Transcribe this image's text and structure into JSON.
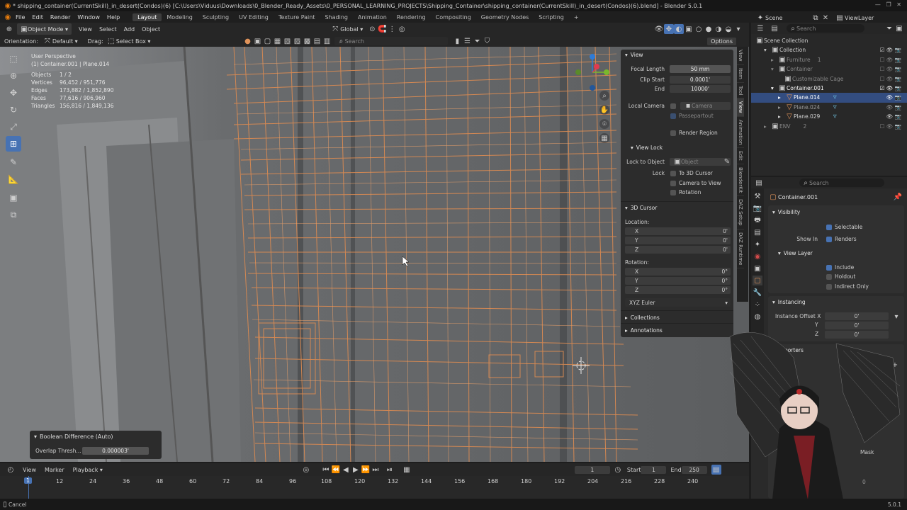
{
  "window": {
    "title": "* shipping_container(CurrentSkill)_in_desert(Condos)(6) [C:\\Users\\Viduus\\Downloads\\0_Blender_Ready_Assets\\0_PERSONAL_LEARNING_PROJECTS\\Shipping_Container\\shipping_container(CurrentSkill)_in_desert(Condos)(6).blend] - Blender 5.0.1"
  },
  "menu": [
    "File",
    "Edit",
    "Render",
    "Window",
    "Help"
  ],
  "workspaces": [
    "Layout",
    "Modeling",
    "Sculpting",
    "UV Editing",
    "Texture Paint",
    "Shading",
    "Animation",
    "Rendering",
    "Compositing",
    "Geometry Nodes",
    "Scripting"
  ],
  "workspace_add": "+",
  "scene": {
    "label": "Scene",
    "viewlayer": "ViewLayer"
  },
  "viewport_header": {
    "mode": "Object Mode",
    "menus": [
      "View",
      "Select",
      "Add",
      "Object"
    ],
    "transform": "Global",
    "options": "Options"
  },
  "sub_header": {
    "orientation_label": "Orientation:",
    "orientation_value": "Default",
    "drag_label": "Drag:",
    "drag_value": "Select Box",
    "search_placeholder": "Search"
  },
  "overlay_info": {
    "perspective": "User Perspective",
    "context": "(1) Container.001 | Plane.014"
  },
  "stats": [
    {
      "label": "Objects",
      "value": "1 / 2"
    },
    {
      "label": "Vertices",
      "value": "96,452 / 951,776"
    },
    {
      "label": "Edges",
      "value": "173,882 / 1,852,890"
    },
    {
      "label": "Faces",
      "value": "77,616 / 906,960"
    },
    {
      "label": "Triangles",
      "value": "156,816 / 1,849,136"
    }
  ],
  "npanel": {
    "view_header": "View",
    "focal_length_label": "Focal Length",
    "focal_length": "50 mm",
    "clip_start_label": "Clip Start",
    "clip_start": "0.0001'",
    "end_label": "End",
    "end": "10000'",
    "local_camera_label": "Local Camera",
    "camera_placeholder": "Camera",
    "passepartout": "Passepartout",
    "render_region": "Render Region",
    "view_lock_header": "View Lock",
    "lock_to_object_label": "Lock to Object",
    "object_placeholder": "Object",
    "lock_label": "Lock",
    "to_3d_cursor": "To 3D Cursor",
    "camera_to_view": "Camera to View",
    "rotation_cb": "Rotation",
    "cursor_header": "3D Cursor",
    "location_label": "Location:",
    "rotation_label": "Rotation:",
    "x": "X",
    "y": "Y",
    "z": "Z",
    "loc": [
      "0'",
      "0'",
      "0'"
    ],
    "rot": [
      "0°",
      "0°",
      "0°"
    ],
    "rot_mode": "XYZ Euler",
    "collections": "Collections",
    "annotations": "Annotations"
  },
  "side_tabs": [
    "View",
    "Item",
    "Tool",
    "View",
    "Animation",
    "Edit",
    "BlenderKit",
    "DAZ Setup",
    "DAZ Runtime"
  ],
  "outliner": {
    "search_placeholder": "Search",
    "rows": [
      {
        "label": "Scene Collection",
        "indent": 0,
        "dim": false
      },
      {
        "label": "Collection",
        "indent": 1,
        "dim": false
      },
      {
        "label": "Furniture",
        "indent": 2,
        "dim": true
      },
      {
        "label": "Container",
        "indent": 2,
        "dim": true
      },
      {
        "label": "Customizable Cage",
        "indent": 3,
        "dim": true
      },
      {
        "label": "Container.001",
        "indent": 2,
        "dim": false
      },
      {
        "label": "Plane.014",
        "indent": 3,
        "dim": false,
        "selected": true
      },
      {
        "label": "Plane.024",
        "indent": 3,
        "dim": true
      },
      {
        "label": "Plane.029",
        "indent": 3,
        "dim": false
      },
      {
        "label": "ENV",
        "indent": 1,
        "dim": true
      }
    ],
    "furniture_count": "1",
    "env_count": "2"
  },
  "properties": {
    "search_placeholder": "Search",
    "object_name": "Container.001",
    "visibility_header": "Visibility",
    "selectable": "Selectable",
    "show_in_label": "Show In",
    "renders": "Renders",
    "view_layer_header": "View Layer",
    "include": "Include",
    "holdout": "Holdout",
    "indirect_only": "Indirect Only",
    "instancing_header": "Instancing",
    "instance_offset_label": "Instance Offset X",
    "y": "Y",
    "z": "Z",
    "offsets": [
      "0'",
      "0'",
      "0'"
    ],
    "exporters_header": "Exporters",
    "mask_fragment": "Mask",
    "cut_fragment": "ort"
  },
  "operator_panel": {
    "title": "Boolean Difference (Auto)",
    "label": "Overlap Thresh...",
    "value": "0.000003'"
  },
  "timeline": {
    "menus": [
      "View",
      "Marker",
      "Playback"
    ],
    "current_frame": "1",
    "start_label": "Start",
    "start": "1",
    "end_label": "End",
    "end": "250",
    "ticks": [
      "1",
      "12",
      "24",
      "36",
      "48",
      "60",
      "72",
      "84",
      "96",
      "108",
      "120",
      "132",
      "144",
      "156",
      "168",
      "180",
      "192",
      "204",
      "216",
      "228",
      "240"
    ],
    "extra": "0"
  },
  "status": {
    "left": "Cancel",
    "version": "5.0.1"
  },
  "colors": {
    "accent": "#4772b3",
    "wire": "#e0935a",
    "selected_row": "#334d80"
  }
}
